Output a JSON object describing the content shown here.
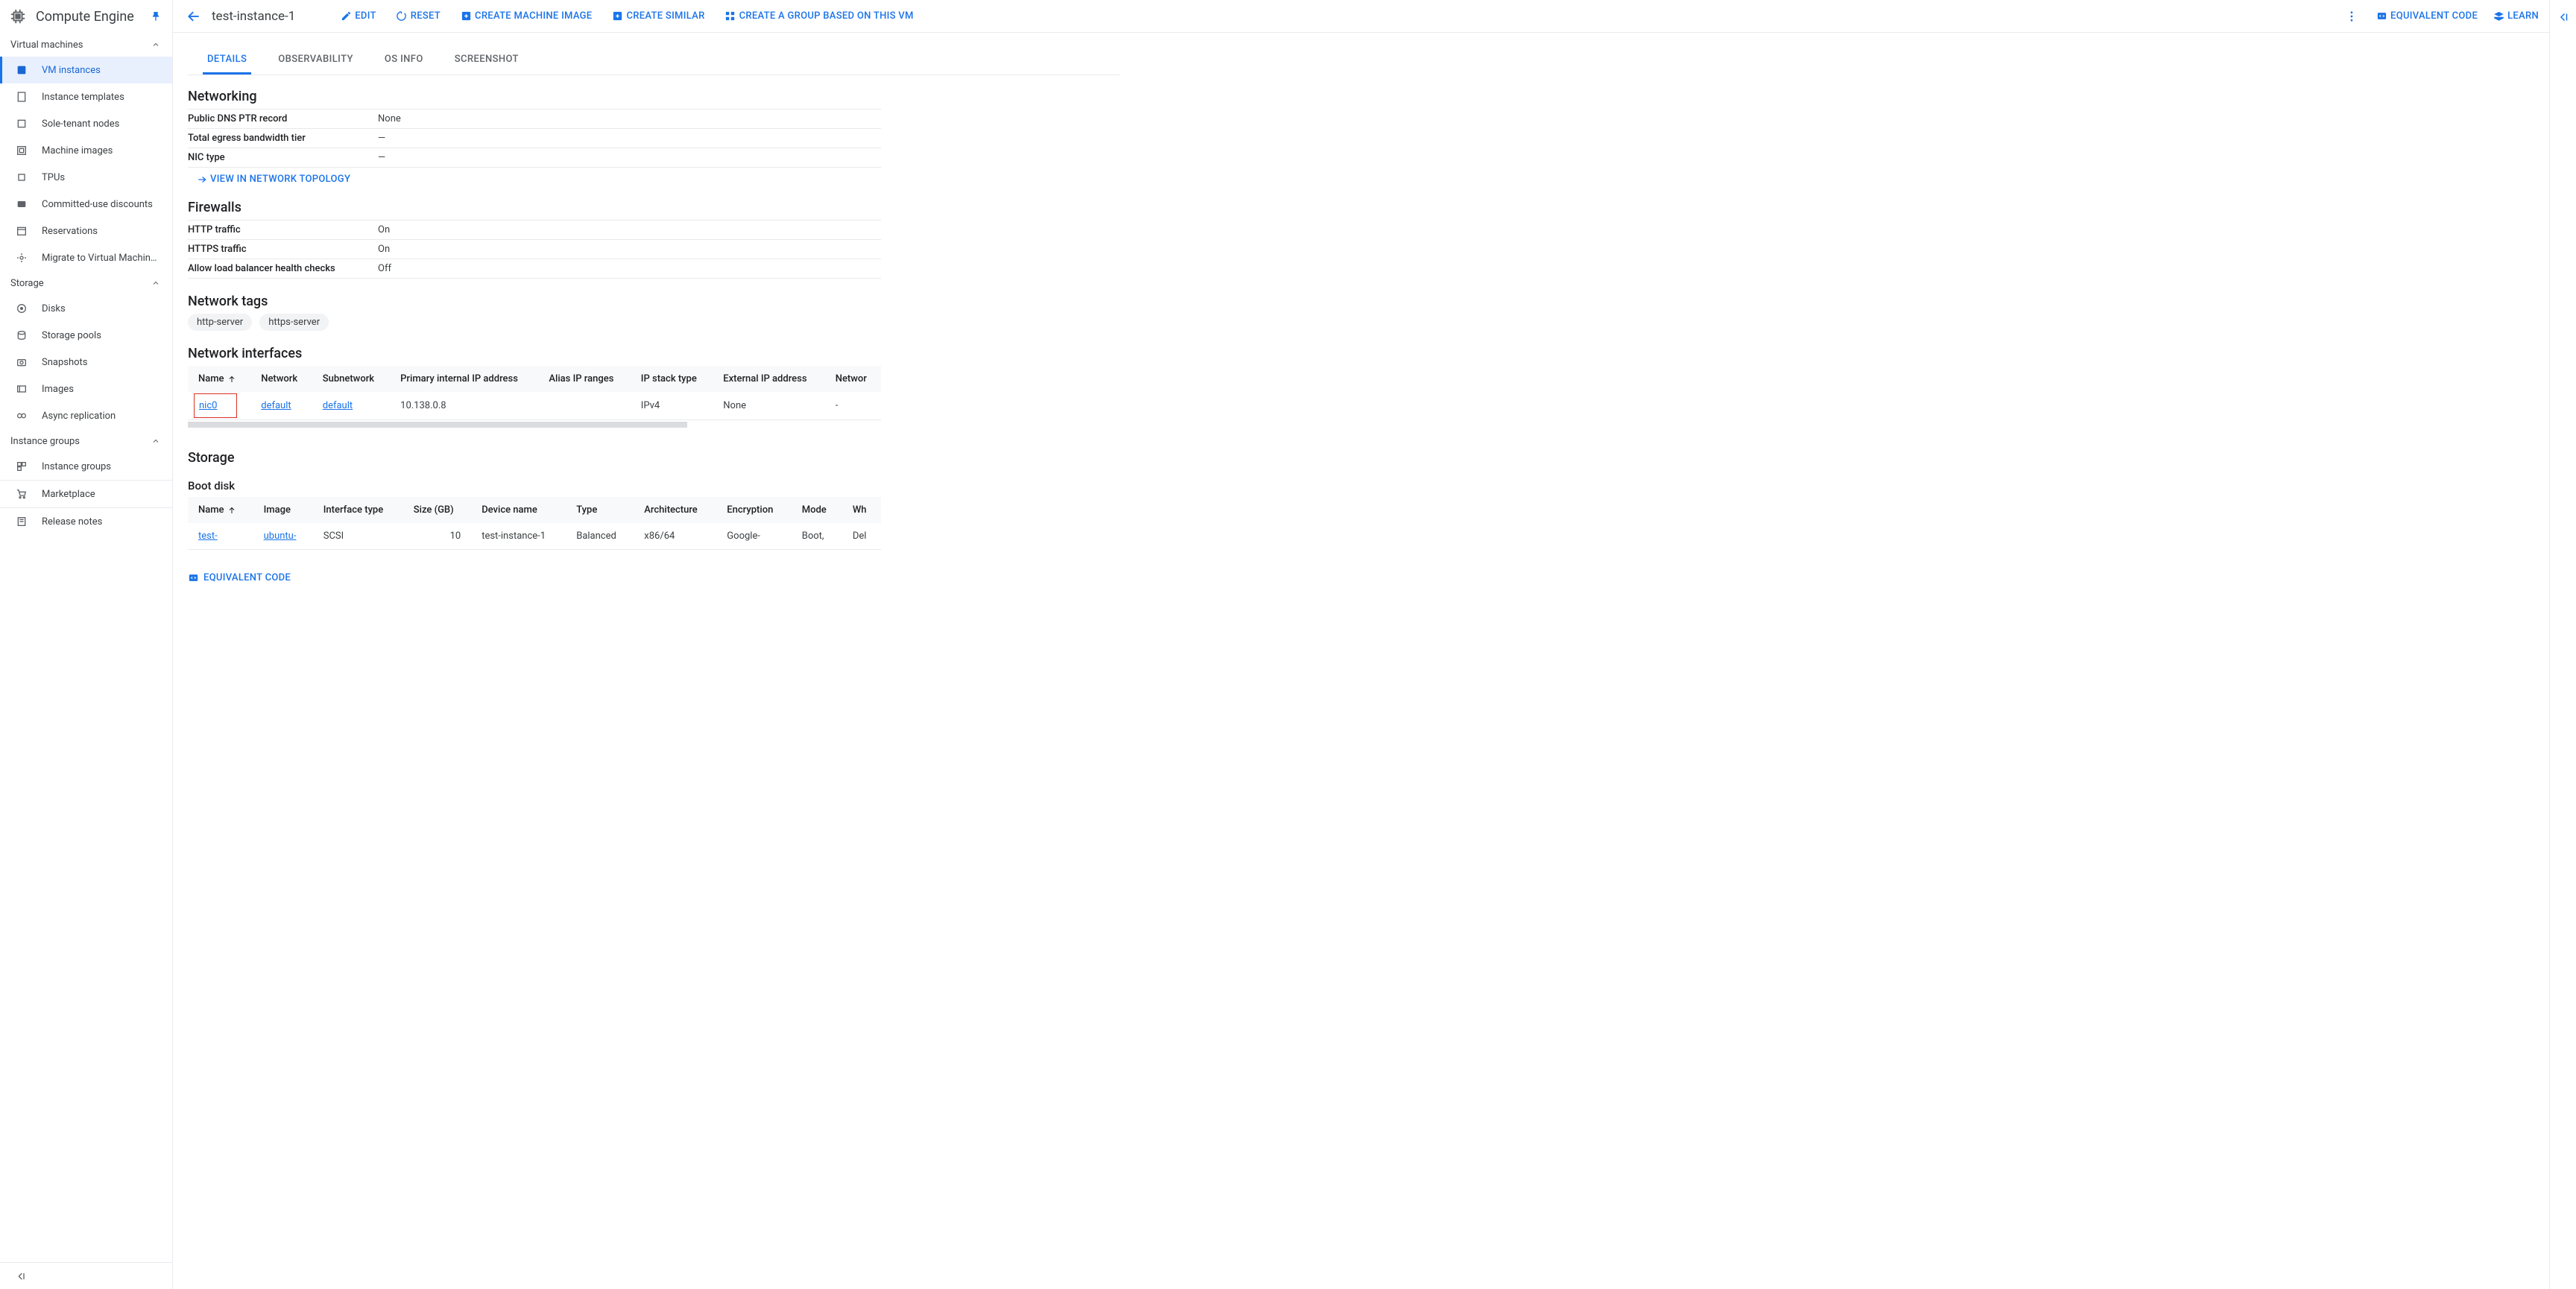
{
  "product": {
    "name": "Compute Engine"
  },
  "sidebar": {
    "sections": [
      {
        "label": "Virtual machines",
        "items": [
          {
            "label": "VM instances"
          },
          {
            "label": "Instance templates"
          },
          {
            "label": "Sole-tenant nodes"
          },
          {
            "label": "Machine images"
          },
          {
            "label": "TPUs"
          },
          {
            "label": "Committed-use discounts"
          },
          {
            "label": "Reservations"
          },
          {
            "label": "Migrate to Virtual Machin…"
          }
        ]
      },
      {
        "label": "Storage",
        "items": [
          {
            "label": "Disks"
          },
          {
            "label": "Storage pools"
          },
          {
            "label": "Snapshots"
          },
          {
            "label": "Images"
          },
          {
            "label": "Async replication"
          }
        ]
      },
      {
        "label": "Instance groups",
        "items": [
          {
            "label": "Instance groups"
          }
        ]
      }
    ],
    "footer": [
      {
        "label": "Marketplace"
      },
      {
        "label": "Release notes"
      }
    ]
  },
  "toolbar": {
    "title": "test-instance-1",
    "actions": {
      "edit": "EDIT",
      "reset": "RESET",
      "create_machine_image": "CREATE MACHINE IMAGE",
      "create_similar": "CREATE SIMILAR",
      "create_group": "CREATE A GROUP BASED ON THIS VM"
    },
    "right": {
      "eq_code": "EQUIVALENT CODE",
      "learn": "LEARN"
    }
  },
  "tabs": {
    "details": "DETAILS",
    "observability": "OBSERVABILITY",
    "os_info": "OS INFO",
    "screenshot": "SCREENSHOT"
  },
  "networking": {
    "heading": "Networking",
    "rows": [
      {
        "k": "Public DNS PTR record",
        "v": "None"
      },
      {
        "k": "Total egress bandwidth tier",
        "v": "—"
      },
      {
        "k": "NIC type",
        "v": "—"
      }
    ],
    "view_topology": "VIEW IN NETWORK TOPOLOGY"
  },
  "firewalls": {
    "heading": "Firewalls",
    "rows": [
      {
        "k": "HTTP traffic",
        "v": "On"
      },
      {
        "k": "HTTPS traffic",
        "v": "On"
      },
      {
        "k": "Allow load balancer health checks",
        "v": "Off"
      }
    ]
  },
  "network_tags": {
    "heading": "Network tags",
    "tags": [
      "http-server",
      "https-server"
    ]
  },
  "nics": {
    "heading": "Network interfaces",
    "cols": [
      "Name",
      "Network",
      "Subnetwork",
      "Primary internal IP address",
      "Alias IP ranges",
      "IP stack type",
      "External IP address",
      "Networ"
    ],
    "row": {
      "name": "nic0",
      "network": "default",
      "subnetwork": "default",
      "primary_ip": "10.138.0.8",
      "alias": "",
      "ip_stack": "IPv4",
      "external_ip": "None",
      "network_tier": "-"
    }
  },
  "storage": {
    "heading": "Storage",
    "boot_heading": "Boot disk",
    "cols": [
      "Name",
      "Image",
      "Interface type",
      "Size (GB)",
      "Device name",
      "Type",
      "Architecture",
      "Encryption",
      "Mode",
      "Wh"
    ],
    "row": {
      "name": "test-",
      "image": "ubuntu-",
      "interface": "SCSI",
      "size": "10",
      "device": "test-instance-1",
      "type": "Balanced",
      "arch": "x86/64",
      "encryption": "Google-",
      "mode": "Boot,",
      "when": "Del"
    }
  },
  "eq_code_bottom": "EQUIVALENT CODE"
}
